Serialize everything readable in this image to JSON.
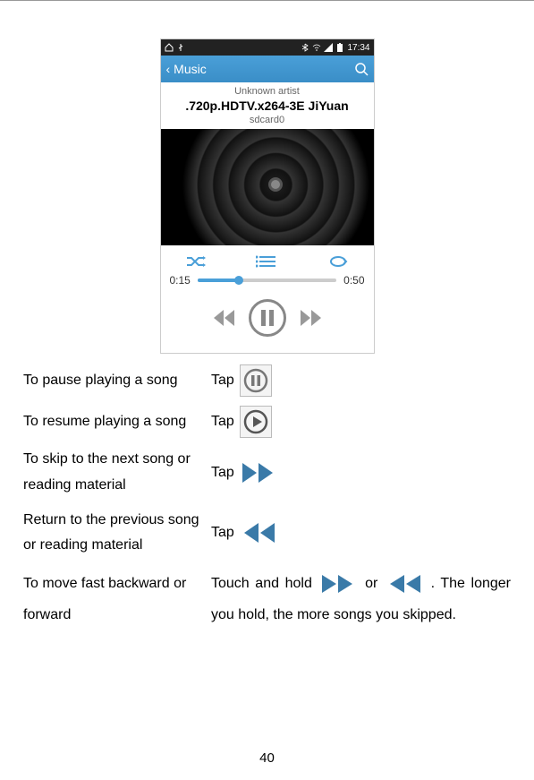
{
  "statusbar": {
    "time": "17:34"
  },
  "titlebar": {
    "title": "Music"
  },
  "track": {
    "artist": "Unknown artist",
    "title": ".720p.HDTV.x264-3E JiYuan",
    "storage": "sdcard0"
  },
  "progress": {
    "elapsed": "0:15",
    "total": "0:50"
  },
  "instructions": {
    "pause": {
      "label": "To pause playing a song",
      "action": "Tap"
    },
    "resume": {
      "label": "To resume playing a song",
      "action": "Tap"
    },
    "next": {
      "label": "To skip to the next song or reading material",
      "action": "Tap"
    },
    "prev": {
      "label": "Return to the previous song or reading material",
      "action": "Tap"
    },
    "seek": {
      "label": "To move fast backward or forward",
      "text1": "Touch and hold ",
      "text2": " or ",
      "text3": " . The longer you hold, the more songs you skipped."
    }
  },
  "page_number": "40"
}
